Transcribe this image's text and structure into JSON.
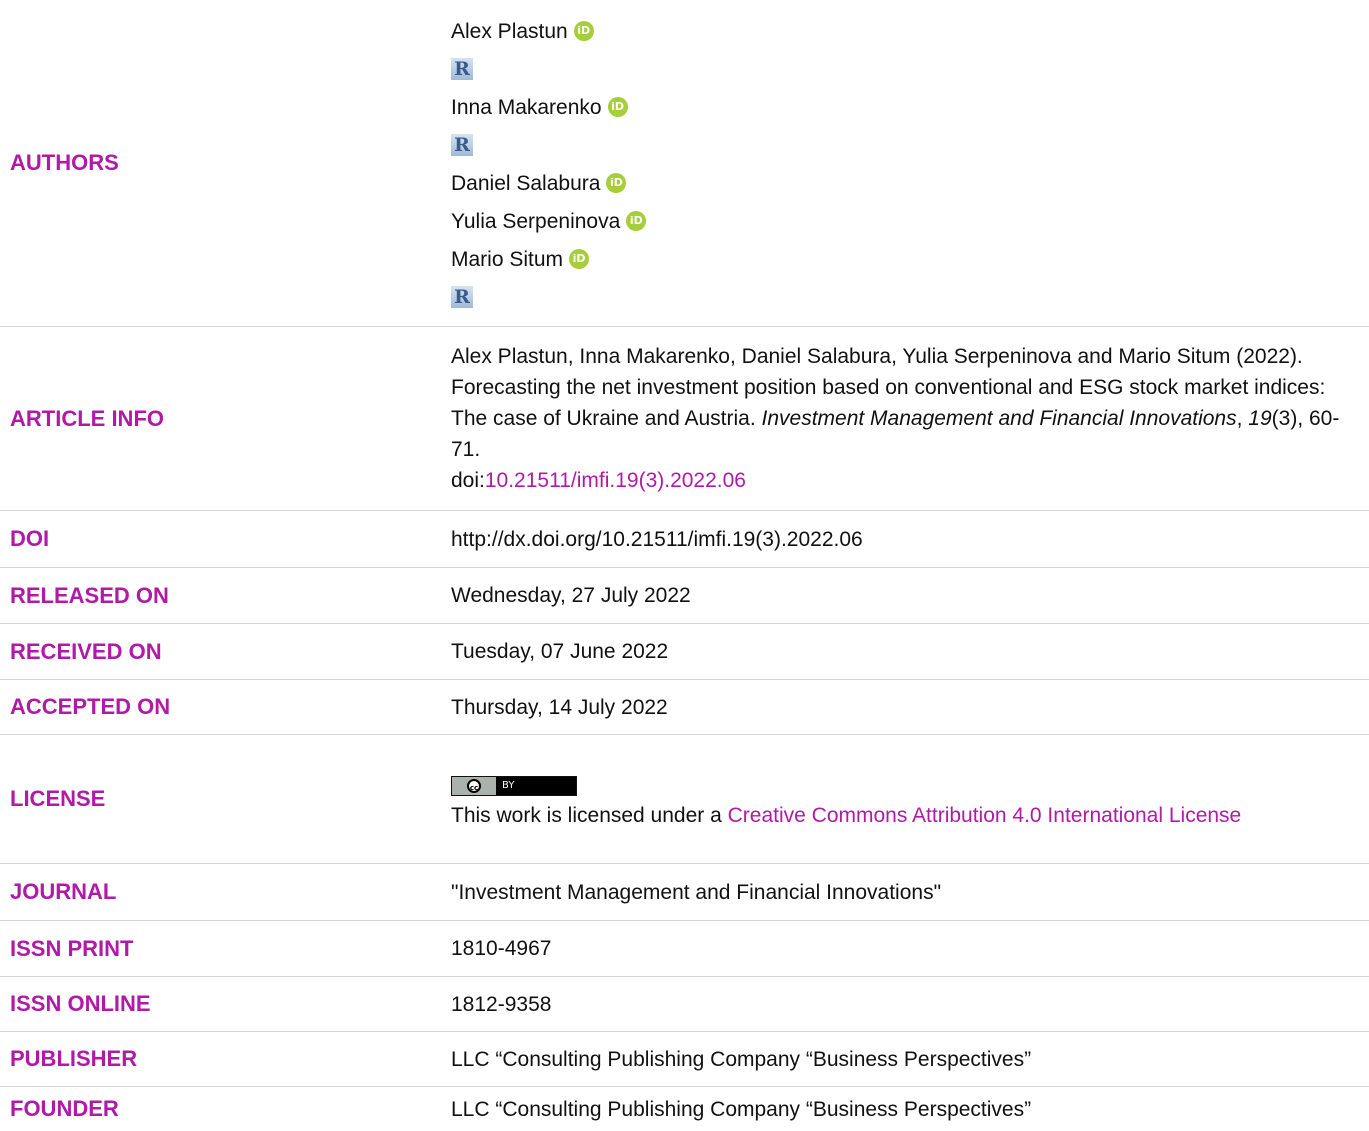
{
  "labels": {
    "authors": "AUTHORS",
    "article_info": "ARTICLE INFO",
    "doi": "DOI",
    "released_on": "RELEASED ON",
    "received_on": "RECEIVED ON",
    "accepted_on": "ACCEPTED ON",
    "license": "LICENSE",
    "journal": "JOURNAL",
    "issn_print": "ISSN PRINT",
    "issn_online": "ISSN ONLINE",
    "publisher": "PUBLISHER",
    "founder": "FOUNDER"
  },
  "authors": [
    {
      "name": "Alex Plastun",
      "orcid": true,
      "researcherid": true
    },
    {
      "name": "Inna Makarenko",
      "orcid": true,
      "researcherid": true
    },
    {
      "name": "Daniel Salabura",
      "orcid": true,
      "researcherid": false
    },
    {
      "name": "Yulia Serpeninova",
      "orcid": true,
      "researcherid": false
    },
    {
      "name": "Mario Situm",
      "orcid": true,
      "researcherid": true
    }
  ],
  "icons": {
    "orcid_glyph": "iD",
    "researcherid_glyph": "R",
    "orcid_color": "#a6ce39"
  },
  "article_info": {
    "citation_prefix": "Alex Plastun, Inna Makarenko, Daniel Salabura, Yulia Serpeninova and Mario Situm (2022). Forecasting the net investment position based on conventional and ESG stock market indices: The case of Ukraine and Austria. ",
    "journal_italic": "Investment Management and Financial Innovations",
    "comma1": ", ",
    "volume_italic": "19",
    "issue_pages": "(3), 60-71.",
    "doi_prefix": "doi:",
    "doi_link": "10.21511/imfi.19(3).2022.06"
  },
  "doi": "http://dx.doi.org/10.21511/imfi.19(3).2022.06",
  "released_on": "Wednesday, 27 July 2022",
  "received_on": "Tuesday, 07 June 2022",
  "accepted_on": "Thursday, 14 July 2022",
  "license": {
    "badge_left": "cc",
    "badge_right": "BY",
    "text_prefix": "This work is licensed under a ",
    "link_text": "Creative Commons Attribution 4.0 International License"
  },
  "journal": "\"Investment Management and Financial Innovations\"",
  "issn_print": "1810-4967",
  "issn_online": "1812-9358",
  "publisher": "LLC “Consulting Publishing Company “Business Perspectives”",
  "founder": "LLC “Consulting Publishing Company “Business Perspectives”",
  "colors": {
    "label": "#b01aa7",
    "link": "#b01aa7",
    "divider": "#d4d4d4"
  }
}
